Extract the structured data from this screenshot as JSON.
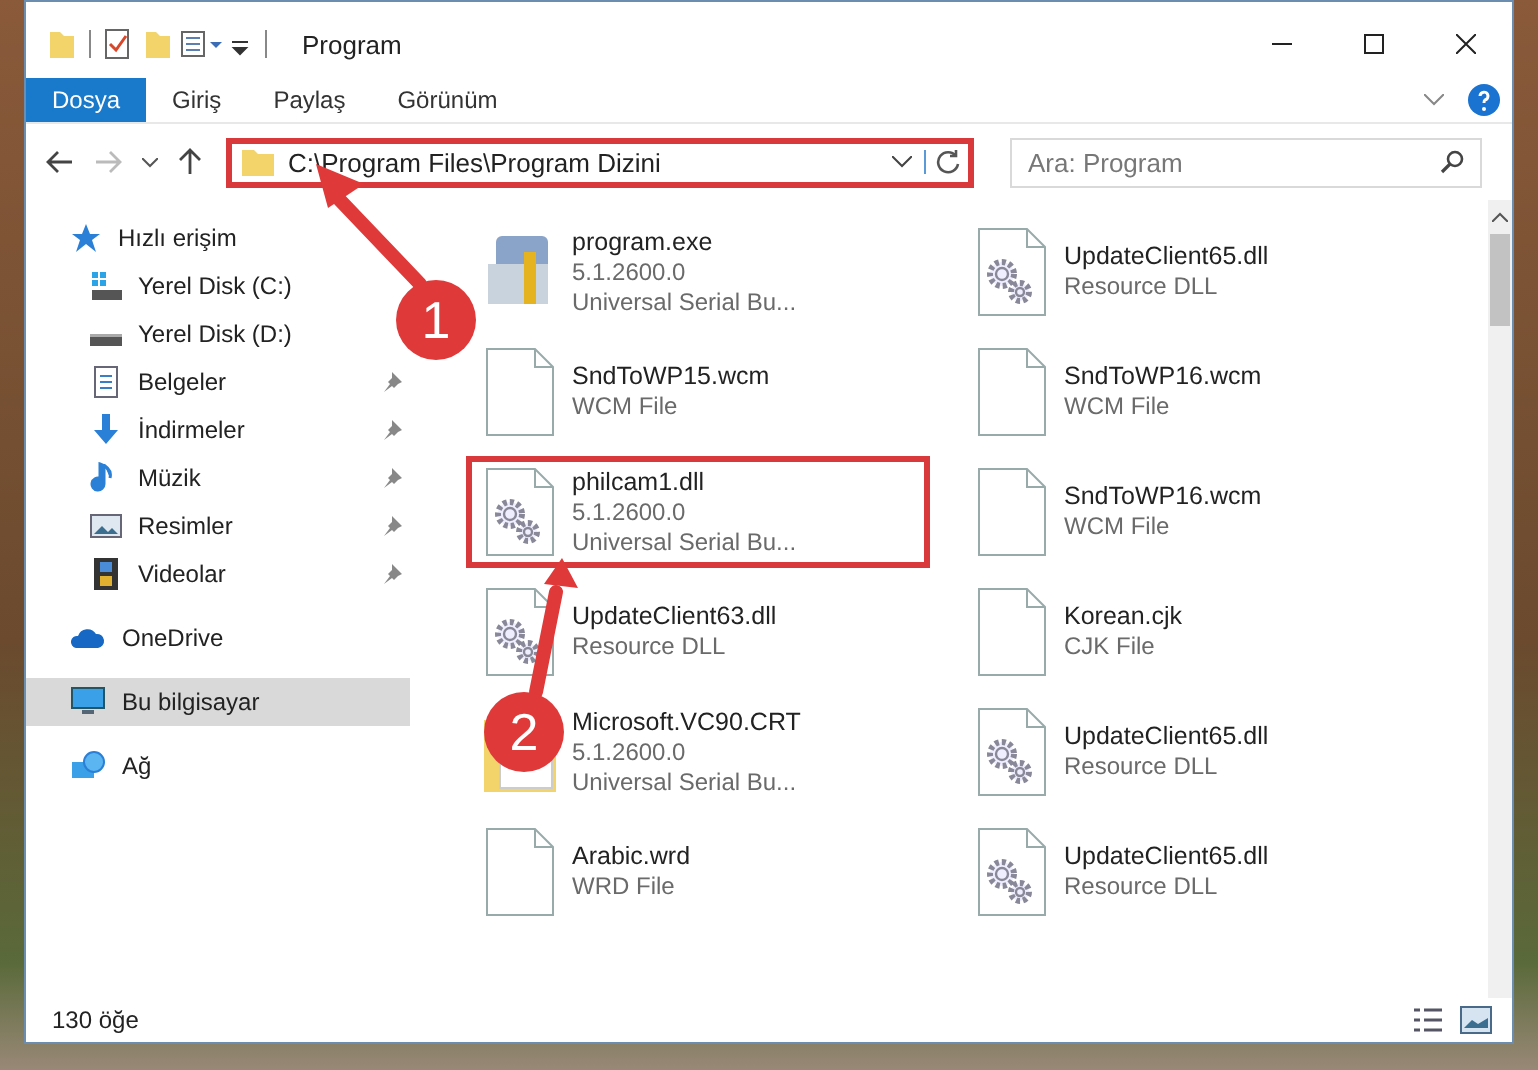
{
  "window": {
    "title": "Program"
  },
  "ribbon_tabs": [
    {
      "label": "Dosya",
      "selected": true
    },
    {
      "label": "Giriş",
      "selected": false
    },
    {
      "label": "Paylaş",
      "selected": false
    },
    {
      "label": "Görünüm",
      "selected": false
    }
  ],
  "address_bar": {
    "path": "C:\\Program Files\\Program Dizini",
    "annotated": true
  },
  "search": {
    "placeholder": "Ara: Program"
  },
  "sidebar": {
    "items": [
      {
        "label": "Hızlı erişim",
        "kind": "star",
        "pinned": false,
        "selected": false,
        "sub": false
      },
      {
        "label": "Yerel Disk (C:)",
        "kind": "drive-win",
        "pinned": false,
        "selected": false,
        "sub": true
      },
      {
        "label": "Yerel Disk (D:)",
        "kind": "drive",
        "pinned": false,
        "selected": false,
        "sub": true
      },
      {
        "label": "Belgeler",
        "kind": "document",
        "pinned": true,
        "selected": false,
        "sub": true
      },
      {
        "label": "İndirmeler",
        "kind": "download",
        "pinned": true,
        "selected": false,
        "sub": true
      },
      {
        "label": "Müzik",
        "kind": "music",
        "pinned": true,
        "selected": false,
        "sub": true
      },
      {
        "label": "Resimler",
        "kind": "pictures",
        "pinned": true,
        "selected": false,
        "sub": true
      },
      {
        "label": "Videolar",
        "kind": "video",
        "pinned": true,
        "selected": false,
        "sub": true
      },
      {
        "label": "OneDrive",
        "kind": "cloud",
        "pinned": false,
        "selected": false,
        "sub": false
      },
      {
        "label": "Bu bilgisayar",
        "kind": "computer",
        "pinned": false,
        "selected": true,
        "sub": false
      },
      {
        "label": "Ağ",
        "kind": "network",
        "pinned": false,
        "selected": false,
        "sub": false
      }
    ]
  },
  "files": [
    {
      "name": "program.exe",
      "lines": [
        "5.1.2600.0",
        "Universal Serial Bu..."
      ],
      "kind": "exe",
      "highlighted": false
    },
    {
      "name": "UpdateClient65.dll",
      "lines": [
        "Resource DLL"
      ],
      "kind": "gear",
      "highlighted": false
    },
    {
      "name": "SndToWP15.wcm",
      "lines": [
        "WCM File"
      ],
      "kind": "text",
      "highlighted": false
    },
    {
      "name": "SndToWP16.wcm",
      "lines": [
        "WCM File"
      ],
      "kind": "text",
      "highlighted": false
    },
    {
      "name": "philcam1.dll",
      "lines": [
        "5.1.2600.0",
        "Universal Serial Bu..."
      ],
      "kind": "gear",
      "highlighted": true
    },
    {
      "name": "SndToWP16.wcm",
      "lines": [
        "WCM File"
      ],
      "kind": "text",
      "highlighted": false
    },
    {
      "name": "UpdateClient63.dll",
      "lines": [
        "Resource DLL"
      ],
      "kind": "gear",
      "highlighted": false
    },
    {
      "name": "Korean.cjk",
      "lines": [
        "CJK File"
      ],
      "kind": "text",
      "highlighted": false
    },
    {
      "name": "Microsoft.VC90.CRT",
      "lines": [
        "5.1.2600.0",
        "Universal Serial Bu..."
      ],
      "kind": "folder",
      "highlighted": false
    },
    {
      "name": "UpdateClient65.dll",
      "lines": [
        "Resource DLL"
      ],
      "kind": "gear",
      "highlighted": false
    },
    {
      "name": "Arabic.wrd",
      "lines": [
        "WRD File"
      ],
      "kind": "text",
      "highlighted": false
    },
    {
      "name": "UpdateClient65.dll",
      "lines": [
        "Resource DLL"
      ],
      "kind": "gear",
      "highlighted": false
    }
  ],
  "status_bar": {
    "count": "130 öğe"
  },
  "annotations": [
    {
      "number": "1"
    },
    {
      "number": "2"
    }
  ]
}
